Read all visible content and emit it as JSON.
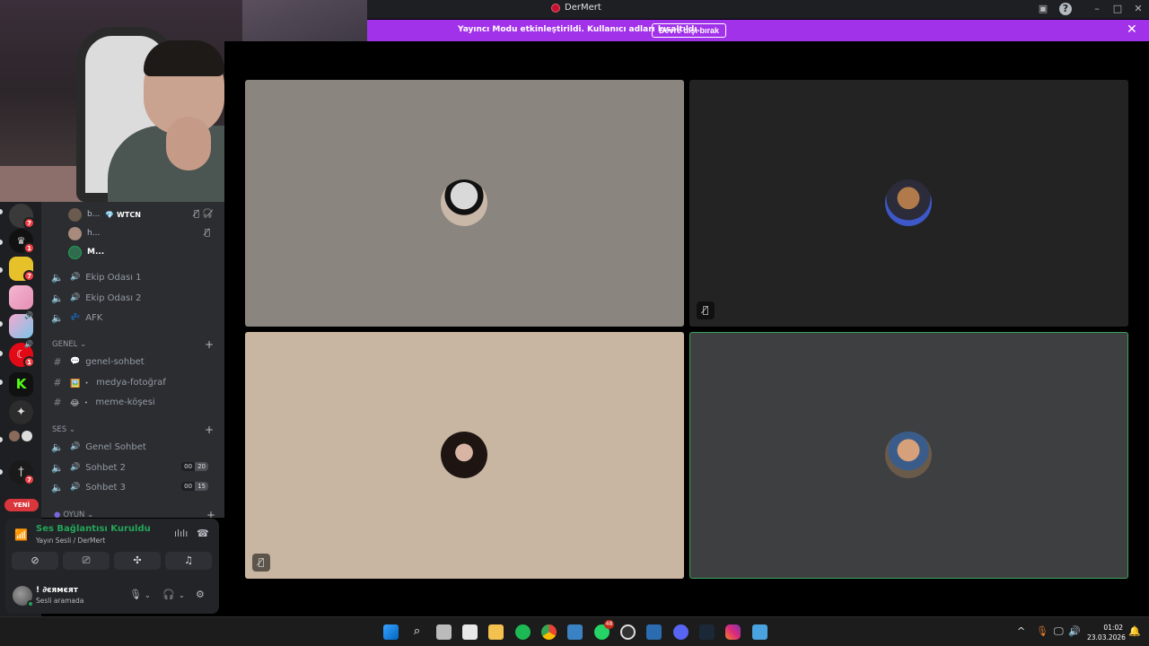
{
  "window": {
    "title": "DerMert"
  },
  "banner": {
    "message": "Yayıncı Modu etkinleştirildi. Kullanıcı adları kısaltıldı.",
    "button": "Devre dışı bırak"
  },
  "rail": {
    "badges": [
      "7",
      "1",
      "7",
      "1",
      "7"
    ],
    "new_label": "YENİ"
  },
  "voice_users": [
    {
      "name": "b...",
      "tag": "💎 WTCN"
    },
    {
      "name": "h..."
    },
    {
      "name": "M..."
    }
  ],
  "channels": {
    "voice_top": [
      "Ekip Odası 1",
      "Ekip Odası 2",
      "AFK"
    ],
    "genel_label": "GENEL",
    "genel": [
      {
        "prefix": "💬",
        "name": "genel-sohbet"
      },
      {
        "prefix": "🖼️ ・",
        "name": "medya-fotoğraf"
      },
      {
        "prefix": "😂 ・",
        "name": "meme-köşesi"
      }
    ],
    "ses_label": "SES",
    "ses": [
      {
        "name": "Genel Sohbet"
      },
      {
        "name": "Sohbet 2",
        "count_a": "00",
        "count_b": "20"
      },
      {
        "name": "Sohbet 3",
        "count_a": "00",
        "count_b": "15"
      }
    ],
    "oyun_label": "OYUN"
  },
  "voice_panel": {
    "status": "Ses Bağlantısı Kuruldu",
    "channel": "Yayın Sesli / DerMert"
  },
  "user_panel": {
    "name": "! ∂єямєят",
    "status": "Sesli aramada"
  },
  "taskbar": {
    "whatsapp_badge": "48",
    "time": "01:02",
    "date": "23.03.2026"
  },
  "colors": {
    "banner": "#a232e9",
    "tile1": "#8a857f",
    "tile2": "#232323",
    "tile3": "#c8b6a2",
    "tile4": "#3e3f41",
    "speaking_border": "#3ba55d"
  }
}
